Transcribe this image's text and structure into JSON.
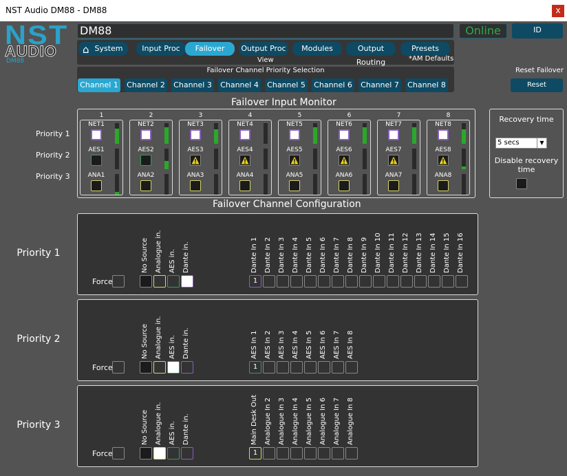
{
  "window": {
    "title": "NST Audio DM88 - DM88",
    "close": "x"
  },
  "logo": {
    "line1": "NST",
    "line2": "AUDIO",
    "line3": "DM88"
  },
  "header": {
    "device_name": "DM88",
    "status": "Online",
    "id_button": "ID"
  },
  "nav": {
    "home_icon": "home-icon",
    "tabs": [
      "System",
      "Input Proc",
      "Failover",
      "Output Proc",
      "Modules",
      "Output Routing",
      "Presets"
    ],
    "active": "Failover",
    "view_label": "View",
    "am_defaults": "*AM Defaults"
  },
  "channel_select": {
    "title": "Failover Channel Priority Selection",
    "channels": [
      "Channel 1",
      "Channel 2",
      "Channel 3",
      "Channel 4",
      "Channel 5",
      "Channel 6",
      "Channel 7",
      "Channel 8"
    ],
    "active": "Channel 1"
  },
  "reset": {
    "label": "Reset Failover",
    "button": "Reset"
  },
  "monitor": {
    "title": "Failover Input Monitor",
    "priority_labels": [
      "Priority 1",
      "Priority 2",
      "Priority 3"
    ],
    "channels": [
      {
        "num": "1",
        "net": "NET1",
        "aes": "AES1",
        "ana": "ANA1",
        "aes_warn": false,
        "levels": [
          0.75,
          0,
          0.15
        ]
      },
      {
        "num": "2",
        "net": "NET2",
        "aes": "AES2",
        "ana": "ANA2",
        "aes_warn": false,
        "levels": [
          0.8,
          0.4,
          0
        ]
      },
      {
        "num": "3",
        "net": "NET3",
        "aes": "AES3",
        "ana": "ANA3",
        "aes_warn": true,
        "levels": [
          0.7,
          0,
          0
        ]
      },
      {
        "num": "4",
        "net": "NET4",
        "aes": "AES4",
        "ana": "ANA4",
        "aes_warn": true,
        "levels": [
          0,
          0,
          0
        ]
      },
      {
        "num": "5",
        "net": "NET5",
        "aes": "AES5",
        "ana": "ANA5",
        "aes_warn": true,
        "levels": [
          0.8,
          0,
          0
        ]
      },
      {
        "num": "6",
        "net": "NET6",
        "aes": "AES6",
        "ana": "ANA6",
        "aes_warn": true,
        "levels": [
          0.8,
          0,
          0
        ]
      },
      {
        "num": "7",
        "net": "NET7",
        "aes": "AES7",
        "ana": "ANA7",
        "aes_warn": true,
        "levels": [
          0.8,
          0,
          0
        ]
      },
      {
        "num": "8",
        "net": "NET8",
        "aes": "AES8",
        "ana": "ANA8",
        "aes_warn": true,
        "levels": [
          0.7,
          0.15,
          0
        ]
      }
    ]
  },
  "recovery": {
    "label": "Recovery time",
    "value": "5 secs",
    "disable_label": "Disable recovery time"
  },
  "config": {
    "title": "Failover Channel Configuration",
    "force_label": "Force",
    "source_types": [
      "No Source",
      "Analogue in.",
      "AES in.",
      "Dante in."
    ],
    "priorities": [
      {
        "label": "Priority 1",
        "selected_source": 3,
        "inputs": [
          "Dante In 1",
          "Dante In 2",
          "Dante In 3",
          "Dante In 4",
          "Dante In 5",
          "Dante In 6",
          "Dante In 7",
          "Dante In 8",
          "Dante In 9",
          "Dante In 10",
          "Dante In 11",
          "Dante In 12",
          "Dante In 13",
          "Dante In 14",
          "Dante In 15",
          "Dante In 16"
        ],
        "selected_input": "1"
      },
      {
        "label": "Priority 2",
        "selected_source": 2,
        "inputs": [
          "AES In 1",
          "AES In 2",
          "AES In 3",
          "AES In 4",
          "AES In 5",
          "AES In 6",
          "AES In 7",
          "AES In 8"
        ],
        "selected_input": "1"
      },
      {
        "label": "Priority 3",
        "selected_source": 1,
        "inputs": [
          "Main Desk Out",
          "Analogue In 2",
          "Analogue In 3",
          "Analogue In 4",
          "Analogue In 5",
          "Analogue In 6",
          "Analogue In 7",
          "Analogue In 8"
        ],
        "selected_input": "1"
      }
    ]
  },
  "colors": {
    "accent": "#2aa8d2",
    "button": "#0e4a63",
    "net": "#8b5fbf",
    "aes": "#3a9a5a",
    "ana": "#d6d66a",
    "meter": "#2aa82a",
    "online": "#2fa84f"
  }
}
